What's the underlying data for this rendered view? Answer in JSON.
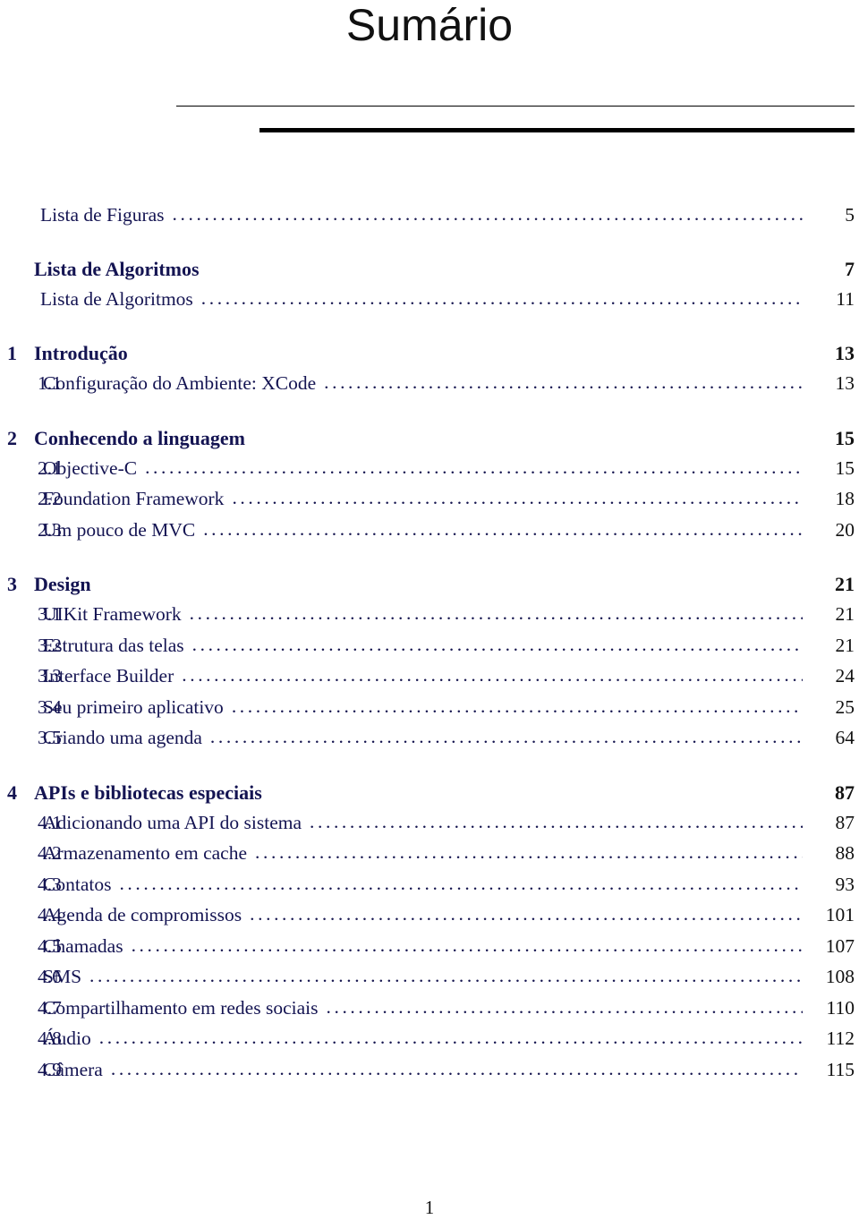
{
  "document": {
    "title": "Sumário",
    "folio": "1",
    "text_color": "#141452",
    "page_number_color": "#111111"
  },
  "toc": {
    "entries": [
      {
        "kind": "front",
        "number": "",
        "title": "Lista de Figuras",
        "page": "5",
        "leader": true,
        "gap_before": false
      },
      {
        "kind": "front-bold",
        "number": "",
        "title": "Lista de Algoritmos",
        "page": "7",
        "leader": false,
        "gap_before": true
      },
      {
        "kind": "front",
        "number": "",
        "title": "Lista de Algoritmos",
        "page": "11",
        "leader": true,
        "gap_before": false
      },
      {
        "kind": "chapter",
        "number": "1",
        "title": "Introdução",
        "page": "13",
        "leader": false,
        "gap_before": true
      },
      {
        "kind": "section",
        "number": "1.1",
        "title": "Configuração do Ambiente: XCode",
        "page": "13",
        "leader": true,
        "gap_before": false
      },
      {
        "kind": "chapter",
        "number": "2",
        "title": "Conhecendo a linguagem",
        "page": "15",
        "leader": false,
        "gap_before": true
      },
      {
        "kind": "section",
        "number": "2.1",
        "title": "Objective-C",
        "page": "15",
        "leader": true,
        "gap_before": false
      },
      {
        "kind": "section",
        "number": "2.2",
        "title": "Foundation Framework",
        "page": "18",
        "leader": true,
        "gap_before": false
      },
      {
        "kind": "section",
        "number": "2.3",
        "title": "Um pouco de MVC",
        "page": "20",
        "leader": true,
        "gap_before": false
      },
      {
        "kind": "chapter",
        "number": "3",
        "title": "Design",
        "page": "21",
        "leader": false,
        "gap_before": true
      },
      {
        "kind": "section",
        "number": "3.1",
        "title": "UIKit Framework",
        "page": "21",
        "leader": true,
        "gap_before": false
      },
      {
        "kind": "section",
        "number": "3.2",
        "title": "Estrutura das telas",
        "page": "21",
        "leader": true,
        "gap_before": false
      },
      {
        "kind": "section",
        "number": "3.3",
        "title": "Interface Builder",
        "page": "24",
        "leader": true,
        "gap_before": false
      },
      {
        "kind": "section",
        "number": "3.4",
        "title": "Seu primeiro aplicativo",
        "page": "25",
        "leader": true,
        "gap_before": false
      },
      {
        "kind": "section",
        "number": "3.5",
        "title": "Criando uma agenda",
        "page": "64",
        "leader": true,
        "gap_before": false
      },
      {
        "kind": "chapter",
        "number": "4",
        "title": "APIs e bibliotecas especiais",
        "page": "87",
        "leader": false,
        "gap_before": true
      },
      {
        "kind": "section",
        "number": "4.1",
        "title": "Adicionando uma API do sistema",
        "page": "87",
        "leader": true,
        "gap_before": false
      },
      {
        "kind": "section",
        "number": "4.2",
        "title": "Armazenamento em cache",
        "page": "88",
        "leader": true,
        "gap_before": false
      },
      {
        "kind": "section",
        "number": "4.3",
        "title": "Contatos",
        "page": "93",
        "leader": true,
        "gap_before": false
      },
      {
        "kind": "section",
        "number": "4.4",
        "title": "Agenda de compromissos",
        "page": "101",
        "leader": true,
        "gap_before": false
      },
      {
        "kind": "section",
        "number": "4.5",
        "title": "Chamadas",
        "page": "107",
        "leader": true,
        "gap_before": false
      },
      {
        "kind": "section",
        "number": "4.6",
        "title": "SMS",
        "page": "108",
        "leader": true,
        "gap_before": false
      },
      {
        "kind": "section",
        "number": "4.7",
        "title": "Compartilhamento em redes sociais",
        "page": "110",
        "leader": true,
        "gap_before": false
      },
      {
        "kind": "section",
        "number": "4.8",
        "title": "Áudio",
        "page": "112",
        "leader": true,
        "gap_before": false
      },
      {
        "kind": "section",
        "number": "4.9",
        "title": "Câmera",
        "page": "115",
        "leader": true,
        "gap_before": false
      }
    ]
  }
}
